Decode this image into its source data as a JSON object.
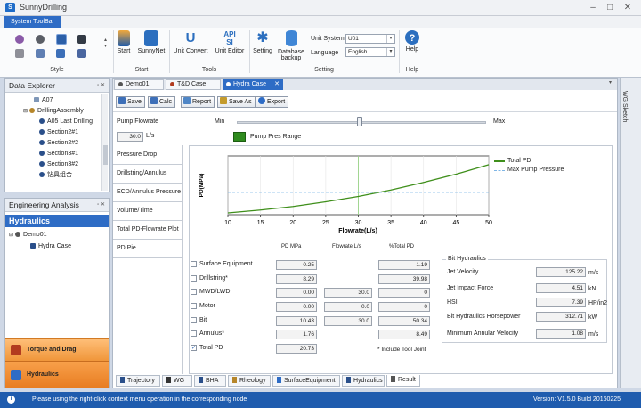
{
  "app": {
    "title": "SunnyDrilling"
  },
  "ribbon_tab": "System ToolBar",
  "groups": {
    "style": "Style",
    "start": "Start",
    "tools": "Tools",
    "setting": "Setting",
    "help": "Help"
  },
  "buttons": {
    "start": "Start",
    "sunnynet": "SunnyNet",
    "unit_convert": "Unit Convert",
    "unit_editor": "Unit Editor",
    "setting": "Setting",
    "database_backup_line1": "Database",
    "database_backup_line2": "backup",
    "help": "Help"
  },
  "unit_system": {
    "label": "Unit System",
    "value": "U01"
  },
  "language": {
    "label": "Language",
    "value": "English"
  },
  "data_explorer": {
    "title": "Data Explorer",
    "items": [
      "A07",
      "DrillingAssembly",
      "A05 Last Drilling",
      "Section2#1",
      "Section2#2",
      "Section3#1",
      "Section3#2",
      "钻具组合"
    ]
  },
  "engineering": {
    "title": "Engineering Analysis",
    "header": "Hydraulics",
    "tree_root": "Demo01",
    "tree_child": "Hydra Case",
    "nav": [
      "Torque and Drag",
      "Hydraulics"
    ]
  },
  "doc_tabs": [
    "Demo01",
    "T&D Case",
    "Hydra Case"
  ],
  "toolbar": {
    "save": "Save",
    "calc": "Calc",
    "report": "Report",
    "save_as": "Save As",
    "export": "Export"
  },
  "pump": {
    "label": "Pump Flowrate",
    "min": "Min",
    "max": "Max",
    "value": "30.0",
    "unit": "L/s",
    "check_label": "Pump Pres Range"
  },
  "left_tabs": [
    "Pressure Drop",
    "Drillstring/Annulus",
    "ECD/Annulus Pressure",
    "Volume/Time",
    "Total PD-Flowrate Plot",
    "PD Pie"
  ],
  "chart_data": {
    "type": "line",
    "xlabel": "Flowrate(L/s)",
    "ylabel": "PD(MPa)",
    "xlim": [
      10,
      50
    ],
    "xticks": [
      10,
      15,
      20,
      25,
      30,
      35,
      40,
      45,
      50
    ],
    "series": [
      {
        "name": "Total PD",
        "x": [
          10,
          15,
          20,
          25,
          30,
          35,
          40,
          45,
          50
        ],
        "y": [
          0.03,
          0.08,
          0.14,
          0.22,
          0.31,
          0.42,
          0.55,
          0.69,
          0.85
        ],
        "color": "#3f8f1b"
      },
      {
        "name": "Max Pump Pressure",
        "x": [
          10,
          50
        ],
        "y": [
          0.38,
          0.38
        ],
        "color": "#7fb6e6"
      }
    ],
    "marker_x": 30,
    "ylim": [
      0,
      1
    ]
  },
  "table": {
    "col_headers": [
      "PD MPa",
      "Flowrate L/s",
      "%Total PD"
    ],
    "rows": [
      {
        "label": "Surface Equipment",
        "pd": "0.25",
        "flow": "",
        "pct": "1.19",
        "checked": false
      },
      {
        "label": "Drillstring*",
        "pd": "8.29",
        "flow": "",
        "pct": "39.98",
        "checked": false
      },
      {
        "label": "MWD/LWD",
        "pd": "0.00",
        "flow": "30.0",
        "pct": "0",
        "checked": false
      },
      {
        "label": "Motor",
        "pd": "0.00",
        "flow": "0.0",
        "pct": "0",
        "checked": false
      },
      {
        "label": "Bit",
        "pd": "10.43",
        "flow": "30.0",
        "pct": "50.34",
        "checked": false
      },
      {
        "label": "Annulus*",
        "pd": "1.76",
        "flow": "",
        "pct": "8.49",
        "checked": false
      },
      {
        "label": "Total PD",
        "pd": "20.73",
        "flow": "",
        "pct": "",
        "checked": true
      }
    ],
    "footnote": "* Include Tool Joint"
  },
  "bit": {
    "title": "Bit Hydraulics",
    "rows": [
      {
        "label": "Jet Velocity",
        "value": "125.22",
        "unit": "m/s"
      },
      {
        "label": "Jet Impact Force",
        "value": "4.51",
        "unit": "kN"
      },
      {
        "label": "HSI",
        "value": "7.39",
        "unit": "HP/in2"
      },
      {
        "label": "Bit Hydraulics Horsepower",
        "value": "312.71",
        "unit": "kW"
      },
      {
        "label": "Minimum Annular Velocity",
        "value": "1.08",
        "unit": "m/s"
      }
    ]
  },
  "bottom_tabs": [
    "Trajectory",
    "WG",
    "BHA",
    "Rheology",
    "SurfaceEquipment",
    "Hydraulics",
    "Result"
  ],
  "side_tab": "WG Sketch",
  "status": {
    "message": "Please using the right-click context menu operation in the corresponding node",
    "version": "Version:  V1.5.0 Build 20160225"
  }
}
